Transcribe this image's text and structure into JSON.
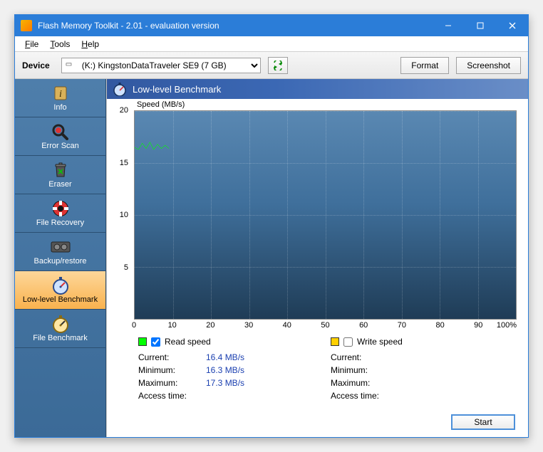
{
  "window": {
    "title": "Flash Memory Toolkit - 2.01 - evaluation version"
  },
  "menu": {
    "file": "File",
    "tools": "Tools",
    "help": "Help"
  },
  "toolbar": {
    "device_label": "Device",
    "device_selected": "(K:) KingstonDataTraveler SE9 (7 GB)",
    "format": "Format",
    "screenshot": "Screenshot"
  },
  "sidebar": {
    "items": [
      {
        "label": "Info"
      },
      {
        "label": "Error Scan"
      },
      {
        "label": "Eraser"
      },
      {
        "label": "File Recovery"
      },
      {
        "label": "Backup/restore"
      },
      {
        "label": "Low-level Benchmark"
      },
      {
        "label": "File Benchmark"
      }
    ]
  },
  "panel": {
    "title": "Low-level Benchmark",
    "chart_label": "Speed (MB/s)",
    "legend": {
      "read": "Read speed",
      "write": "Write speed"
    },
    "stats": {
      "labels": {
        "current": "Current:",
        "minimum": "Minimum:",
        "maximum": "Maximum:",
        "access": "Access time:"
      },
      "read": {
        "current": "16.4 MB/s",
        "minimum": "16.3 MB/s",
        "maximum": "17.3 MB/s",
        "access": ""
      },
      "write": {
        "current": "",
        "minimum": "",
        "maximum": "",
        "access": ""
      }
    },
    "start": "Start"
  },
  "chart_data": {
    "type": "line",
    "title": "Speed (MB/s)",
    "xlabel": "",
    "ylabel": "Speed (MB/s)",
    "xlim": [
      0,
      100
    ],
    "ylim": [
      0,
      20
    ],
    "x_ticks": [
      0,
      10,
      20,
      30,
      40,
      50,
      60,
      70,
      80,
      90,
      100
    ],
    "y_ticks": [
      5,
      10,
      15,
      20
    ],
    "x_tick_labels": [
      "0",
      "10",
      "20",
      "30",
      "40",
      "50",
      "60",
      "70",
      "80",
      "90",
      "100%"
    ],
    "series": [
      {
        "name": "Read speed",
        "color": "#00ff00",
        "x": [
          0,
          1,
          2,
          3,
          4,
          5,
          6,
          7,
          8,
          9
        ],
        "values": [
          16.5,
          16.3,
          16.9,
          16.4,
          17.0,
          16.3,
          16.8,
          16.4,
          16.7,
          16.4
        ]
      },
      {
        "name": "Write speed",
        "color": "#ffd000",
        "x": [],
        "values": []
      }
    ]
  }
}
